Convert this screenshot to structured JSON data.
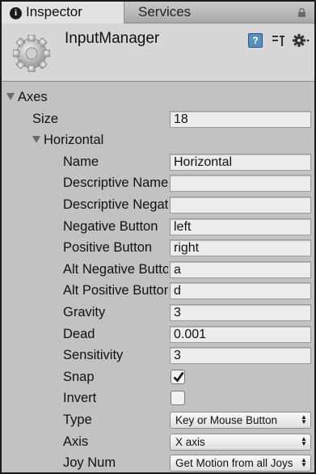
{
  "tabs": {
    "inspector": "Inspector",
    "services": "Services"
  },
  "header": {
    "title": "InputManager"
  },
  "axes": {
    "label": "Axes",
    "size_label": "Size",
    "size_value": "18"
  },
  "horizontal": {
    "label": "Horizontal"
  },
  "fields": [
    {
      "label": "Name",
      "value": "Horizontal"
    },
    {
      "label": "Descriptive Name",
      "value": ""
    },
    {
      "label": "Descriptive Negative Name",
      "value": ""
    },
    {
      "label": "Negative Button",
      "value": "left"
    },
    {
      "label": "Positive Button",
      "value": "right"
    },
    {
      "label": "Alt Negative Button",
      "value": "a"
    },
    {
      "label": "Alt Positive Button",
      "value": "d"
    },
    {
      "label": "Gravity",
      "value": "3"
    },
    {
      "label": "Dead",
      "value": "0.001"
    },
    {
      "label": "Sensitivity",
      "value": "3"
    }
  ],
  "snap": {
    "label": "Snap",
    "checked": true
  },
  "invert": {
    "label": "Invert",
    "checked": false
  },
  "type": {
    "label": "Type",
    "value": "Key or Mouse Button"
  },
  "axis": {
    "label": "Axis",
    "value": "X axis"
  },
  "joy_num": {
    "label": "Joy Num",
    "value": "Get Motion from all Joys"
  },
  "icons": [
    "info-icon",
    "lock-icon",
    "asset-icon",
    "help-book-icon",
    "settings-icon",
    "gear-icon",
    "foldout-arrow-icon",
    "checkmark-icon",
    "dropdown-arrows-icon"
  ]
}
